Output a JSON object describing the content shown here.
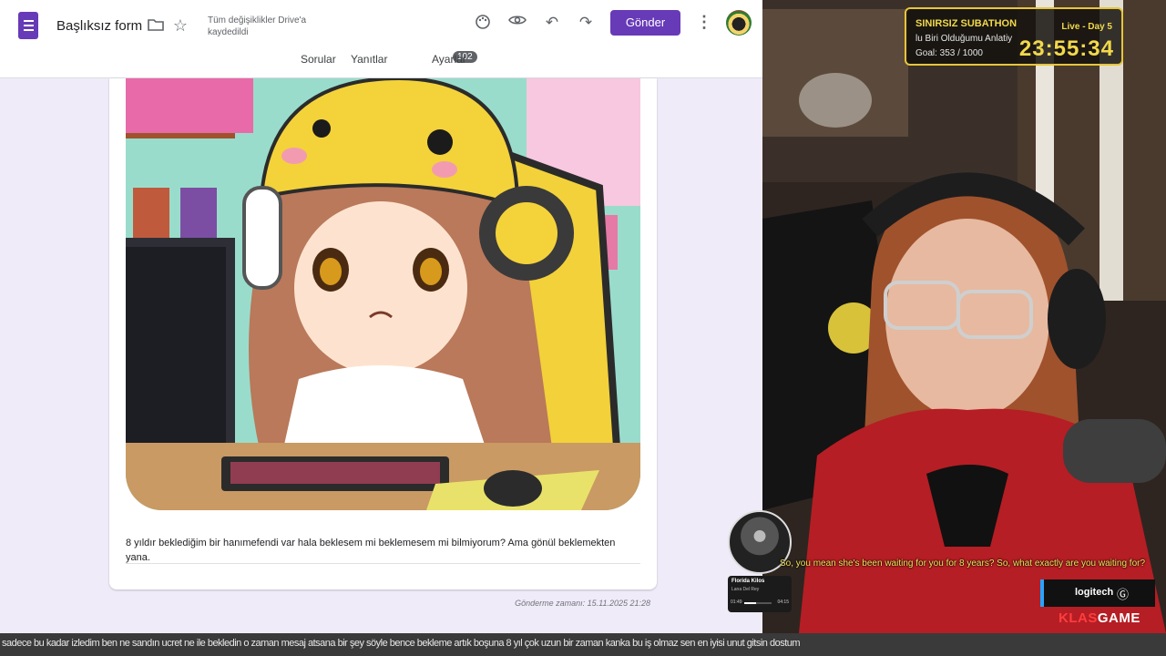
{
  "forms": {
    "title": "Başlıksız form",
    "save_status": "Tüm değişiklikler Drive'a kaydedildi",
    "send_label": "Gönder",
    "tabs": [
      {
        "label": "Sorular"
      },
      {
        "label": "Yanıtlar",
        "count": "102"
      },
      {
        "label": "Ayarlar"
      }
    ],
    "accent_color": "#673ab7",
    "response": {
      "text": "8 yıldır beklediğim bir hanımefendi var hala beklesem mi beklemesem mi bilmiyorum? Ama gönül beklemekten yana.",
      "submitted_at": "Gönderme zamanı: 15.11.2025 21:28"
    }
  },
  "stream": {
    "goal": {
      "title": "SINIRSIZ SUBATHON",
      "subtitle": "lu Biri Olduğumu Anlatiy",
      "count": "Goal: 353 / 1000",
      "live": "Live - Day 5",
      "timer": "23:55:34"
    },
    "music": {
      "title": "Florida Kilos",
      "artist": "Lana Del Rey",
      "elapsed": "01:49",
      "total": "04:15",
      "progress": 0.43
    },
    "caption": "So, you mean she's been waiting for you for 8 years? So, what exactly are you waiting for?",
    "sponsor": "logitech",
    "brand_prefix": "KLAS",
    "brand_suffix": "GAME",
    "ticker": "sadece bu kadar izledim ben ne sandın ucret ne ile bekledin o zaman mesaj atsana bir şey söyle bence bekleme artık boşuna 8 yıl çok uzun bir zaman kanka bu iş olmaz sen en iyisi unut gitsin dostum"
  }
}
